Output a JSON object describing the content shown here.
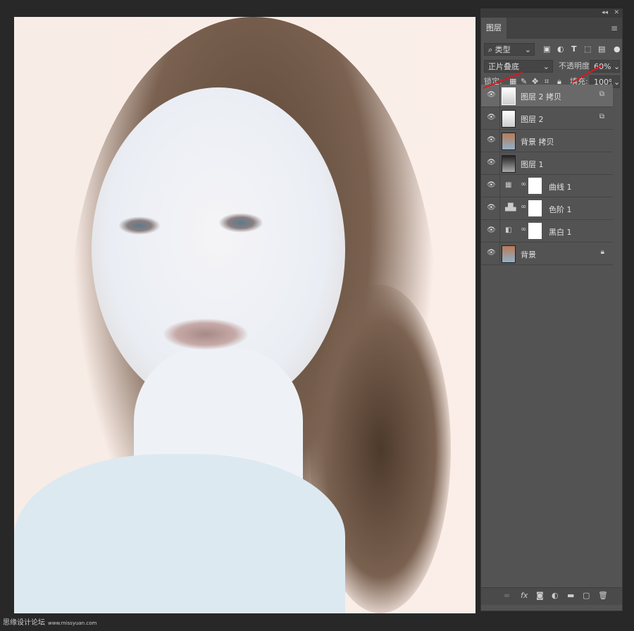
{
  "panel": {
    "tab": "图层",
    "filter": "类型",
    "blend_mode": "正片叠底",
    "opacity_label": "不透明度:",
    "opacity": "60%",
    "lock_label": "锁定:",
    "fill_label": "填充:",
    "fill": "100%"
  },
  "layers": [
    {
      "name": "图层 2 拷贝",
      "type": "pixel",
      "selected": true,
      "badge": "smart-object-icon"
    },
    {
      "name": "图层 2",
      "type": "pixel",
      "badge": "smart-object-icon"
    },
    {
      "name": "背景 拷贝",
      "type": "pixel"
    },
    {
      "name": "图层 1",
      "type": "pixel"
    },
    {
      "name": "曲线 1",
      "type": "adjustment",
      "icon": "curves-icon"
    },
    {
      "name": "色阶 1",
      "type": "adjustment",
      "icon": "levels-icon"
    },
    {
      "name": "黑白 1",
      "type": "adjustment",
      "icon": "black-white-icon"
    },
    {
      "name": "背景",
      "type": "pixel",
      "locked": true
    }
  ],
  "watermark": {
    "site": "思缘设计论坛",
    "url": "www.missyuan.com"
  },
  "colors": {
    "panel": "#535353",
    "selected": "#696969",
    "arrow": "#e0161c"
  }
}
